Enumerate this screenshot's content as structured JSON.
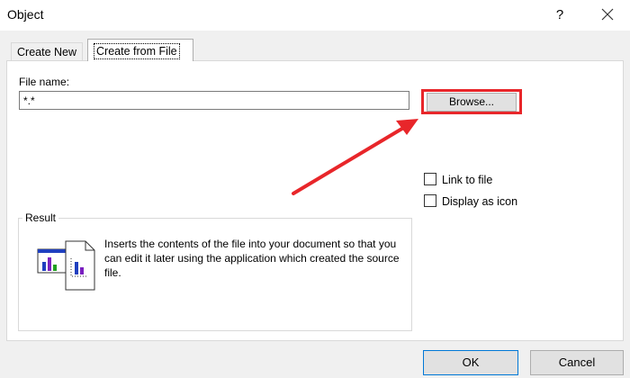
{
  "window": {
    "title": "Object",
    "help_label": "?"
  },
  "tabs": [
    {
      "label": "Create New",
      "active": false
    },
    {
      "label": "Create from File",
      "active": true
    }
  ],
  "file": {
    "label": "File name:",
    "value": "*.*",
    "browse_label": "Browse..."
  },
  "options": {
    "link_label": "Link to file",
    "link_checked": false,
    "icon_label": "Display as icon",
    "icon_checked": false
  },
  "result": {
    "legend": "Result",
    "description": "Inserts the contents of the file into your document so that you can edit it later using the application which created the source file."
  },
  "buttons": {
    "ok_label": "OK",
    "cancel_label": "Cancel"
  },
  "colors": {
    "highlight": "#e8262a",
    "ok_border": "#0078d7"
  },
  "icons": [
    "help-icon",
    "close-icon",
    "result-file-icon",
    "annotation-arrow"
  ]
}
